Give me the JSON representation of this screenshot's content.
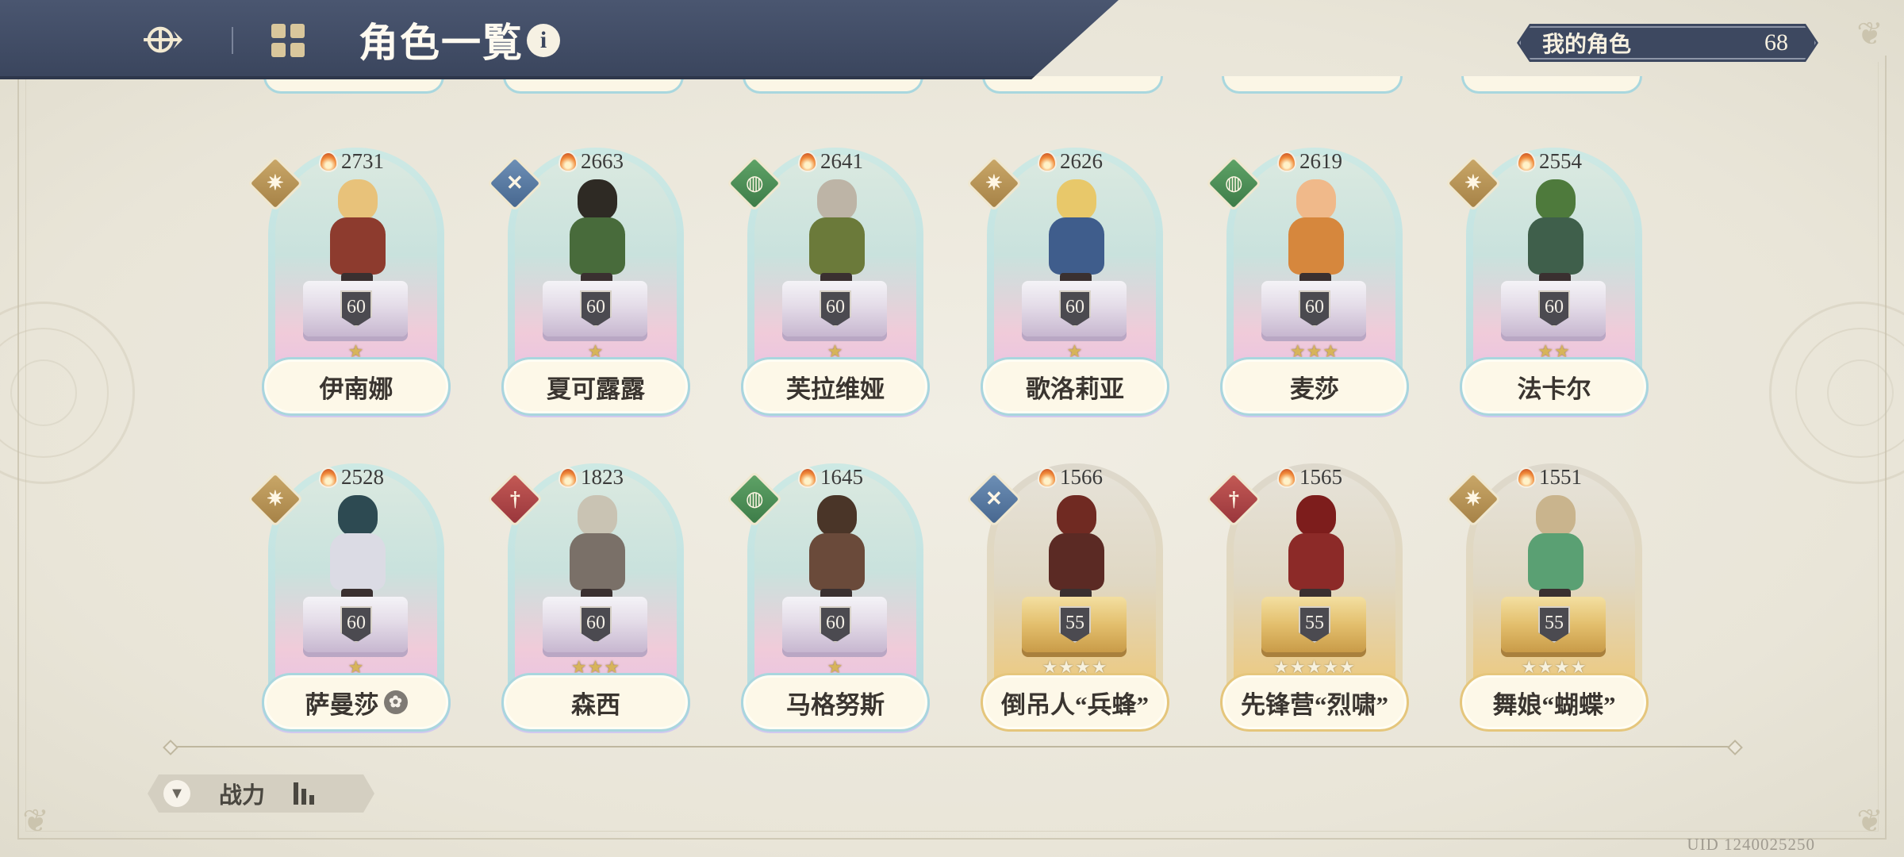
{
  "header": {
    "title": "角色一覧",
    "info_glyph": "i"
  },
  "owned": {
    "label": "我的角色",
    "count": "68"
  },
  "characters": [
    {
      "name": "伊南娜",
      "power": "2731",
      "level": "60",
      "stars": 1,
      "max_stars": 1,
      "element": "light",
      "rarity": "blue"
    },
    {
      "name": "夏可露露",
      "power": "2663",
      "level": "60",
      "stars": 1,
      "max_stars": 1,
      "element": "wind",
      "rarity": "blue"
    },
    {
      "name": "芙拉维娅",
      "power": "2641",
      "level": "60",
      "stars": 1,
      "max_stars": 1,
      "element": "earth",
      "rarity": "blue"
    },
    {
      "name": "歌洛莉亚",
      "power": "2626",
      "level": "60",
      "stars": 1,
      "max_stars": 1,
      "element": "light",
      "rarity": "blue"
    },
    {
      "name": "麦莎",
      "power": "2619",
      "level": "60",
      "stars": 3,
      "max_stars": 3,
      "element": "earth",
      "rarity": "blue"
    },
    {
      "name": "法卡尔",
      "power": "2554",
      "level": "60",
      "stars": 2,
      "max_stars": 2,
      "element": "light",
      "rarity": "blue"
    },
    {
      "name": "萨曼莎",
      "power": "2528",
      "level": "60",
      "stars": 1,
      "max_stars": 1,
      "element": "light",
      "rarity": "blue",
      "badge": true
    },
    {
      "name": "森西",
      "power": "1823",
      "level": "60",
      "stars": 3,
      "max_stars": 3,
      "element": "fire",
      "rarity": "blue"
    },
    {
      "name": "马格努斯",
      "power": "1645",
      "level": "60",
      "stars": 1,
      "max_stars": 1,
      "element": "earth",
      "rarity": "blue"
    },
    {
      "name": "倒吊人“兵蜂”",
      "power": "1566",
      "level": "55",
      "stars": 0,
      "max_stars": 4,
      "element": "wind",
      "rarity": "gold"
    },
    {
      "name": "先锋营“烈啸”",
      "power": "1565",
      "level": "55",
      "stars": 0,
      "max_stars": 5,
      "element": "fire",
      "rarity": "gold"
    },
    {
      "name": "舞娘“蝴蝶”",
      "power": "1551",
      "level": "55",
      "stars": 0,
      "max_stars": 4,
      "element": "light",
      "rarity": "gold"
    }
  ],
  "sort": {
    "label": "战力"
  },
  "uid": "UID 1240025250",
  "element_icons": {
    "light": "light-element-icon",
    "wind": "wind-element-icon",
    "earth": "earth-element-icon",
    "fire": "fire-element-icon"
  }
}
